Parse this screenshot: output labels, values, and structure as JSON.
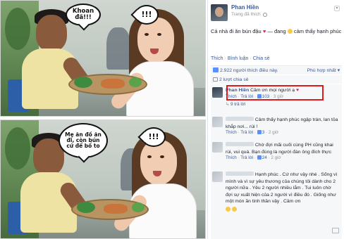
{
  "photos": {
    "top_bubble_left": "Khoan đã!!!",
    "top_bubble_right": "!!!",
    "bottom_bubble_left": "Mẹ ăn đồ ăn đi, còn bún cứ để bố to",
    "bottom_bubble_right": "!!!"
  },
  "post": {
    "author": "Phan Hiền",
    "subtitle": "Trang đã thích",
    "text_before": "Cả nhà đi ăn bún đậu",
    "text_heart": "♥",
    "text_after": " — đang",
    "text_feeling": " cảm thấy hạnh phúc",
    "actions": {
      "like": "Thích",
      "comment": "Bình luận",
      "share": "Chia sẻ"
    },
    "likes_text": "2.922 người thích điều này.",
    "sort_label": "Phù hợp nhất",
    "shares_text": "2 lượt chia sẻ"
  },
  "comments": [
    {
      "author": "Phan Hiền",
      "text": "Cảm ơn mọi người ạ",
      "heart": "♥",
      "like": "Thích",
      "reply": "Trả lời",
      "likes": "103",
      "time": "3 giờ",
      "replies": "9 trả lời"
    },
    {
      "text": "Cảm thấy hạnh phúc ngập tràn, lan tỏa khắp nơi... rùi !",
      "like": "Thích",
      "reply": "Trả lời",
      "likes": "3",
      "time": "2 giờ"
    },
    {
      "text": "Chờ đợi mãi cuối cùng PH cũng khai rùi, vui quá. Bạn đúng là người đàn ông đích thực",
      "like": "Thích",
      "reply": "Trả lời",
      "likes": "24",
      "time": "2 giờ"
    },
    {
      "text": "Hạnh phúc . Cứ như vậy nhé . Sống vì mình và vì sự yêu thương của chúng tôi dành cho 2 người nữa . Yêu 2 người nhiều lắm . Tui luôn chờ đợi sự xuất hiện của 2 người vì điều đó . Giống như một món ăn tinh thần vậy . Cảm ơn"
    }
  ]
}
